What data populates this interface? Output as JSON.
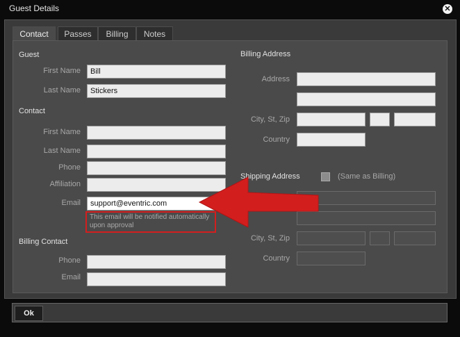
{
  "dialog": {
    "title": "Guest Details"
  },
  "tabs": [
    {
      "label": "Contact",
      "active": true
    },
    {
      "label": "Passes",
      "active": false
    },
    {
      "label": "Billing",
      "active": false
    },
    {
      "label": "Notes",
      "active": false
    }
  ],
  "guest": {
    "section": "Guest",
    "first_name_label": "First Name",
    "first_name": "Bill",
    "last_name_label": "Last Name",
    "last_name": "Stickers"
  },
  "contact": {
    "section": "Contact",
    "first_name_label": "First Name",
    "last_name_label": "Last Name",
    "phone_label": "Phone",
    "affiliation_label": "Affiliation",
    "email_label": "Email",
    "email": "support@eventric.com",
    "email_note": "This email will be notified automatically upon approval"
  },
  "billing_contact": {
    "section": "Billing Contact",
    "phone_label": "Phone",
    "email_label": "Email"
  },
  "billing_address": {
    "section": "Billing Address",
    "address_label": "Address",
    "city_label": "City, St, Zip",
    "country_label": "Country"
  },
  "shipping_address": {
    "section": "Shipping Address",
    "same_as_billing_label": "(Same as Billing)",
    "address_label": "Address",
    "city_label": "City, St, Zip",
    "country_label": "Country"
  },
  "footer": {
    "ok_label": "Ok"
  },
  "colors": {
    "annotation_red": "#d31e1e"
  }
}
